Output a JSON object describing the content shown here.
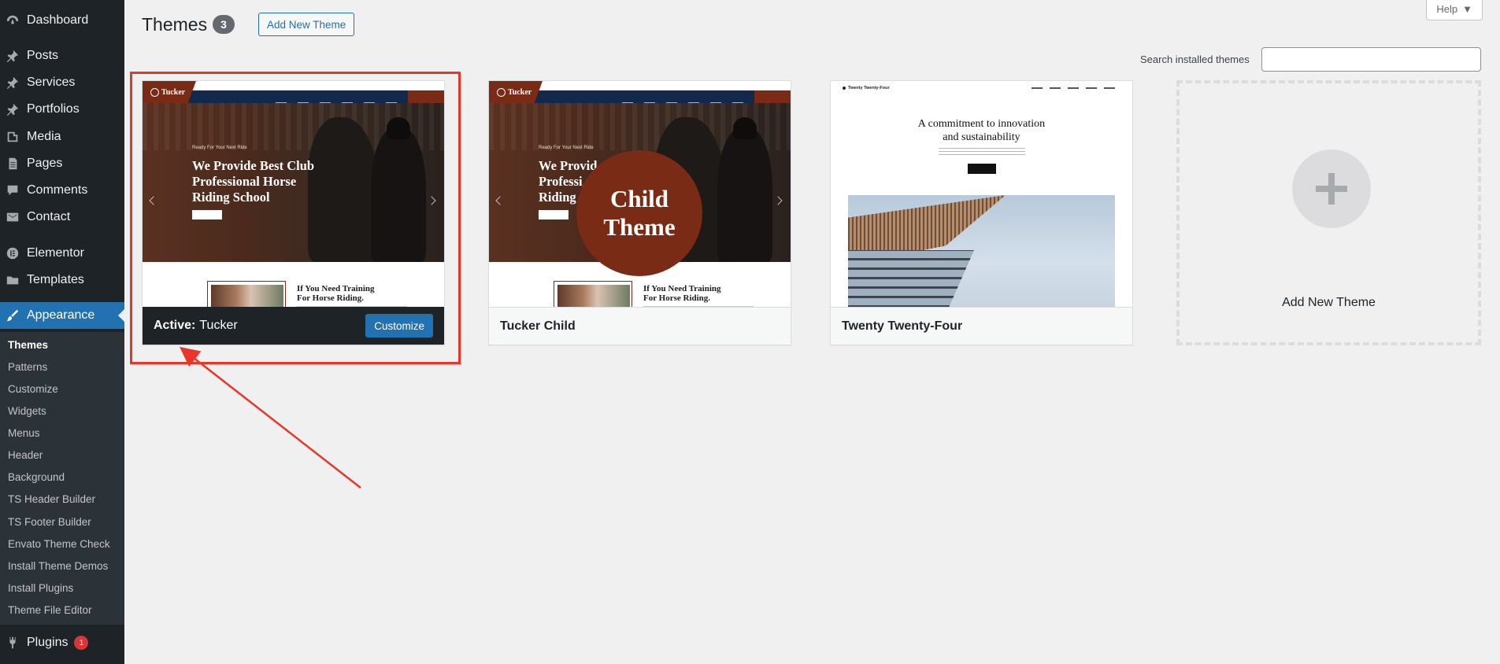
{
  "sidebar": {
    "items": [
      {
        "label": "Dashboard",
        "icon": "dashboard-icon"
      },
      {
        "label": "Posts",
        "icon": "pin-icon"
      },
      {
        "label": "Services",
        "icon": "pin-icon"
      },
      {
        "label": "Portfolios",
        "icon": "pin-icon"
      },
      {
        "label": "Media",
        "icon": "media-icon"
      },
      {
        "label": "Pages",
        "icon": "page-icon"
      },
      {
        "label": "Comments",
        "icon": "comment-icon"
      },
      {
        "label": "Contact",
        "icon": "mail-icon"
      },
      {
        "label": "Elementor",
        "icon": "elementor-icon"
      },
      {
        "label": "Templates",
        "icon": "folder-icon"
      },
      {
        "label": "Appearance",
        "icon": "brush-icon"
      },
      {
        "label": "Plugins",
        "icon": "plug-icon",
        "badge": "1"
      }
    ],
    "appearance_submenu": [
      "Themes",
      "Patterns",
      "Customize",
      "Widgets",
      "Menus",
      "Header",
      "Background",
      "TS Header Builder",
      "TS Footer Builder",
      "Envato Theme Check",
      "Install Theme Demos",
      "Install Plugins",
      "Theme File Editor"
    ]
  },
  "header": {
    "title": "Themes",
    "count": "3",
    "add_new_label": "Add New Theme",
    "help_label": "Help",
    "search_label": "Search installed themes",
    "search_value": ""
  },
  "themes": [
    {
      "name": "Tucker",
      "active_prefix": "Active:",
      "customize_label": "Customize",
      "preview": {
        "hero_small": "Ready For Your Next Ride",
        "hero_title": "We Provide Best Club\nProfessional Horse\nRiding School",
        "lower_title": "If You Need Training\nFor Horse Riding.",
        "brand": "Tucker"
      }
    },
    {
      "name": "Tucker Child",
      "preview": {
        "hero_small": "Ready For Your Next Ride",
        "hero_title": "We Provid\nProfessi\nRiding",
        "lower_title": "If You Need Training\nFor Horse Riding.",
        "brand": "Tucker",
        "badge": "Child\nTheme"
      }
    },
    {
      "name": "Twenty Twenty-Four",
      "preview": {
        "brand": "Twenty Twenty-Four",
        "headline": "A commitment to innovation\nand sustainability"
      }
    }
  ],
  "add_new_tile": {
    "label": "Add New Theme"
  },
  "colors": {
    "sidebar_bg": "#1d2327",
    "accent": "#2271b1",
    "brand_brown": "#7a2b15",
    "annotation_red": "#e8362a"
  }
}
